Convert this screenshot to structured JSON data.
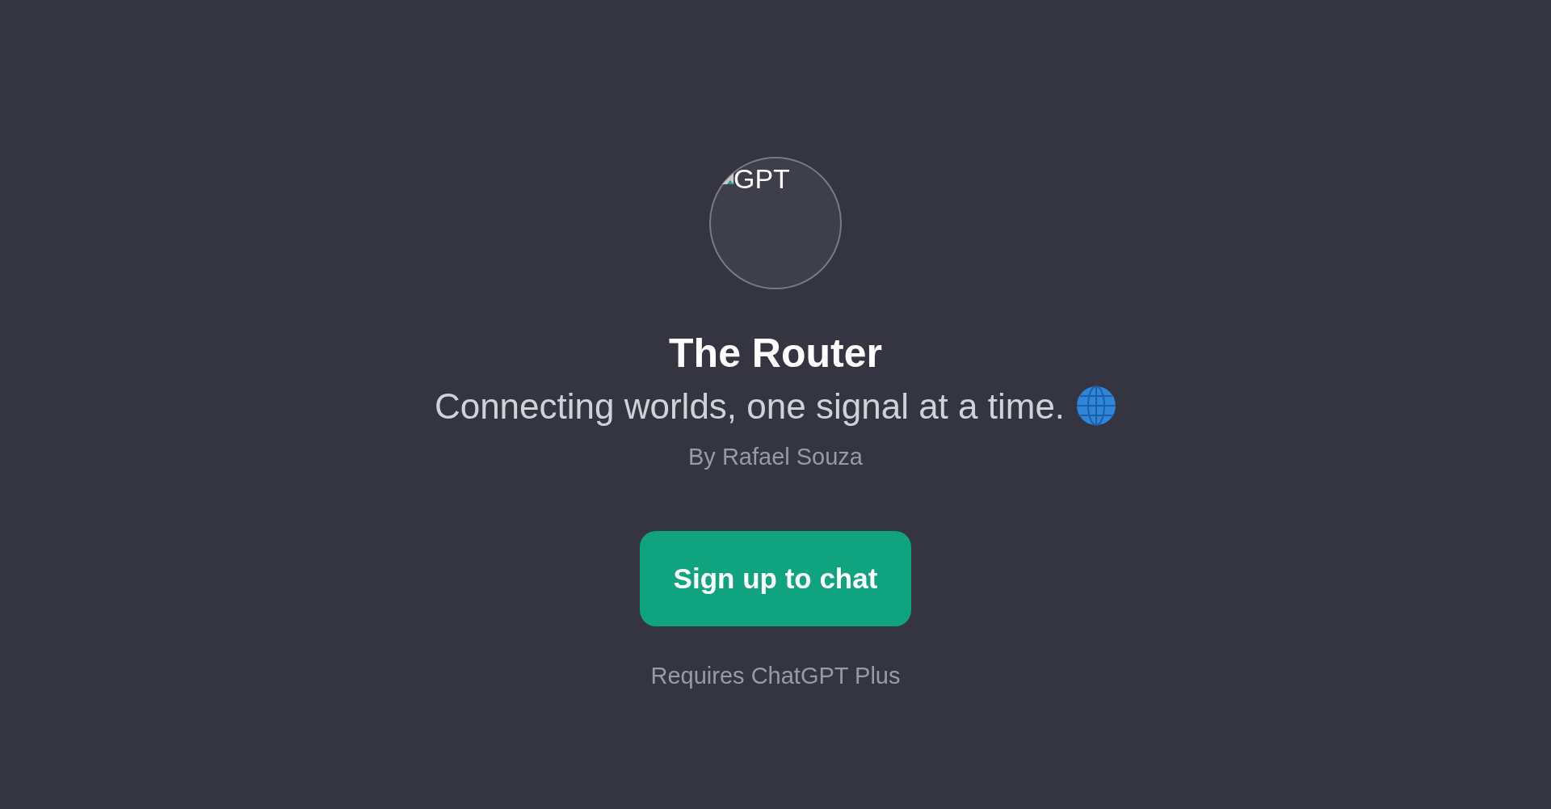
{
  "avatar": {
    "alt_text": "GPT"
  },
  "title": "The Router",
  "subtitle": "Connecting worlds, one signal at a time.",
  "author": "By Rafael Souza",
  "button": "Sign up to chat",
  "note": "Requires ChatGPT Plus"
}
